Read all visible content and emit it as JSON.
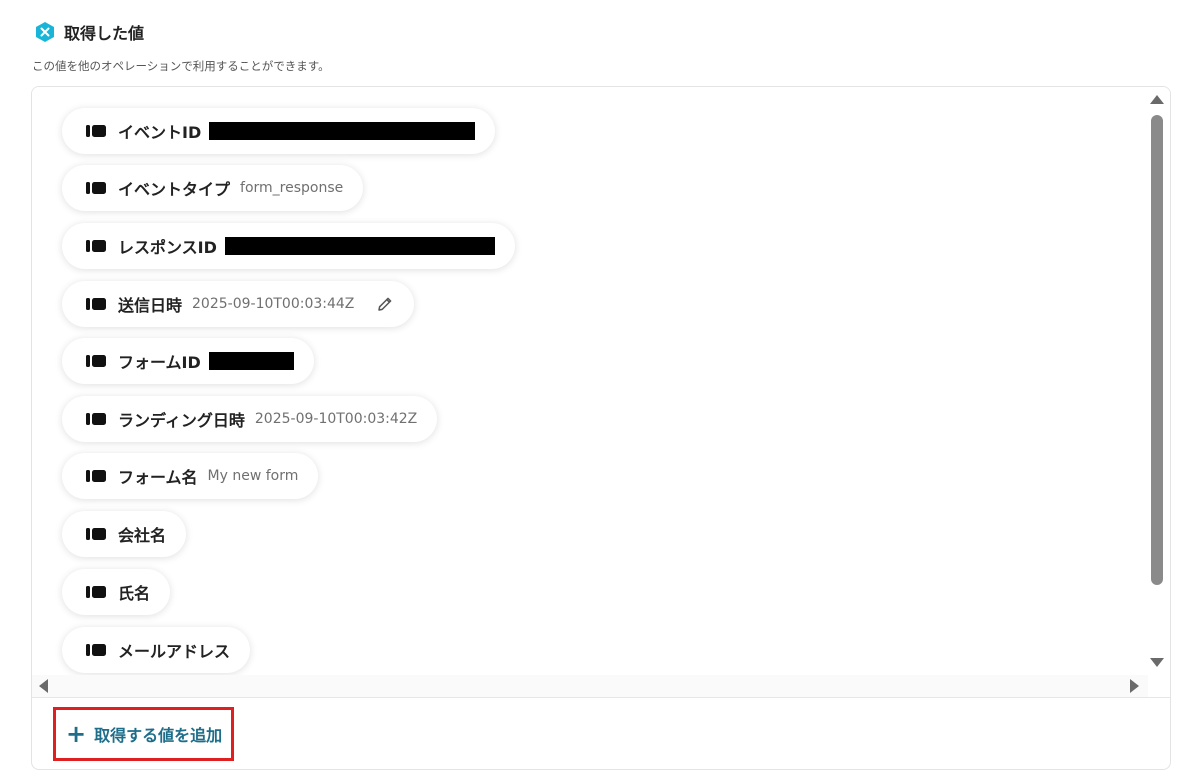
{
  "header": {
    "title": "取得した値",
    "subtitle": "この値を他のオペレーションで利用することができます。"
  },
  "items": [
    {
      "label": "イベントID",
      "value": "",
      "redacted": true
    },
    {
      "label": "イベントタイプ",
      "value": "form_response"
    },
    {
      "label": "レスポンスID",
      "value": "",
      "redacted": true
    },
    {
      "label": "送信日時",
      "value": "2025-09-10T00:03:44Z",
      "editable": true
    },
    {
      "label": "フォームID",
      "value": "",
      "redacted": true
    },
    {
      "label": "ランディング日時",
      "value": "2025-09-10T00:03:42Z"
    },
    {
      "label": "フォーム名",
      "value": "My new form"
    },
    {
      "label": "会社名",
      "value": ""
    },
    {
      "label": "氏名",
      "value": ""
    },
    {
      "label": "メールアドレス",
      "value": ""
    }
  ],
  "add_button": {
    "label": "取得する値を追加",
    "icon": "plus-icon"
  },
  "colors": {
    "accent": "#1e6e8a",
    "highlight_border": "#e02020",
    "logo": "#19b5d8"
  }
}
